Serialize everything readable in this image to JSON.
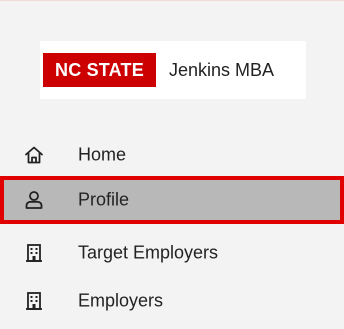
{
  "brand": {
    "logo_primary": "NC STATE",
    "logo_secondary": "Jenkins MBA",
    "primary_color": "#cc0000"
  },
  "nav": {
    "items": [
      {
        "label": "Home",
        "icon": "home-icon",
        "active": false
      },
      {
        "label": "Profile",
        "icon": "user-icon",
        "active": true
      },
      {
        "label": "Target Employers",
        "icon": "building-icon",
        "active": false
      },
      {
        "label": "Employers",
        "icon": "building-icon",
        "active": false
      }
    ],
    "highlight_color": "#e10000"
  }
}
